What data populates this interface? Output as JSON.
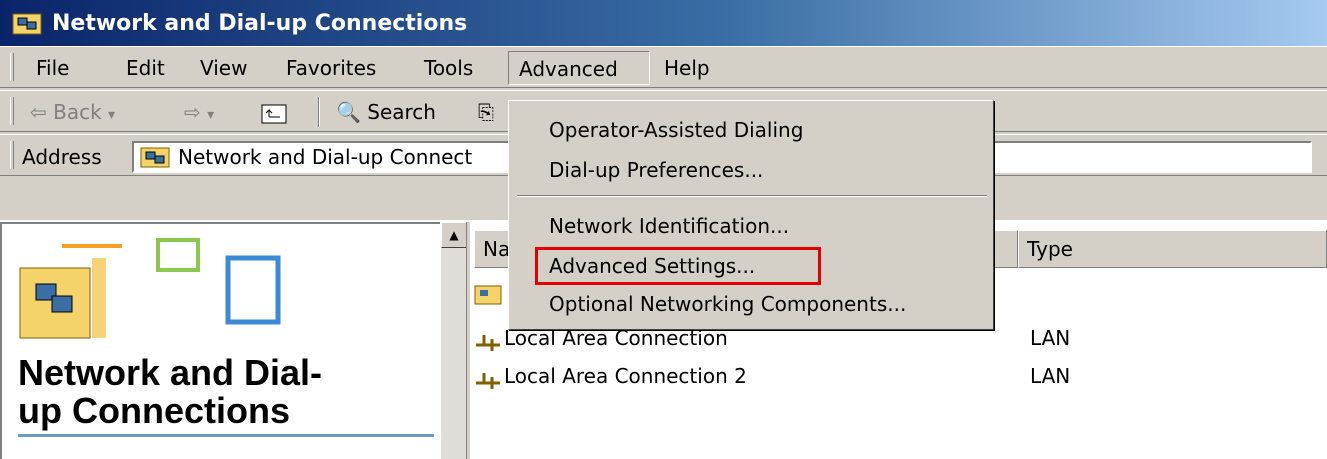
{
  "window": {
    "title": "Network and Dial-up Connections"
  },
  "menubar": {
    "items": [
      {
        "label": "File"
      },
      {
        "label": "Edit"
      },
      {
        "label": "View"
      },
      {
        "label": "Favorites"
      },
      {
        "label": "Tools"
      },
      {
        "label": "Advanced"
      },
      {
        "label": "Help"
      }
    ]
  },
  "toolbar": {
    "back_label": "Back",
    "search_label": "Search"
  },
  "address": {
    "label": "Address",
    "value": "Network and Dial-up Connect"
  },
  "left_pane": {
    "title_line1": "Network and Dial-",
    "title_line2": "up Connections"
  },
  "list": {
    "columns": [
      {
        "label": "Na"
      },
      {
        "label": "Type"
      }
    ],
    "rows": [
      {
        "name": "Local Area Connection",
        "type": "LAN"
      },
      {
        "name": "Local Area Connection 2",
        "type": "LAN"
      }
    ]
  },
  "advanced_menu": {
    "items": [
      {
        "label": "Operator-Assisted Dialing"
      },
      {
        "label": "Dial-up Preferences..."
      },
      {
        "label": "Network Identification..."
      },
      {
        "label": "Advanced Settings..."
      },
      {
        "label": "Optional Networking Components..."
      }
    ],
    "highlighted_index": 3,
    "highlight_color": "#e30000"
  },
  "colors": {
    "title_gradient_start": "#0a246a",
    "title_gradient_end": "#a6caf0",
    "face": "#d4d0c8"
  }
}
